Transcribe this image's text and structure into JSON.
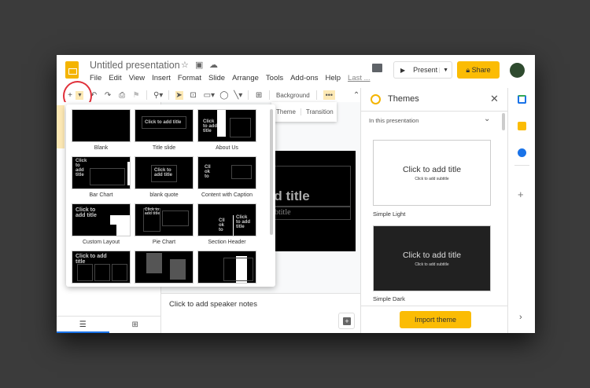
{
  "app": {
    "title": "Untitled presentation"
  },
  "menu": [
    "File",
    "Edit",
    "View",
    "Insert",
    "Format",
    "Slide",
    "Arrange",
    "Tools",
    "Add-ons",
    "Help"
  ],
  "last_edit": "Last ...",
  "header": {
    "present_label": "Present",
    "share_label": "Share"
  },
  "toolbar": {
    "background_label": "Background",
    "more_label": "•••"
  },
  "slide_bubble": {
    "theme_label": "Theme",
    "transition_label": "Transition"
  },
  "layouts": [
    {
      "label": "Blank"
    },
    {
      "label": "Title slide"
    },
    {
      "label": "About Us"
    },
    {
      "label": "Bar Chart"
    },
    {
      "label": "blank quote"
    },
    {
      "label": "Content with Caption"
    },
    {
      "label": "Custom Layout"
    },
    {
      "label": "Pie Chart"
    },
    {
      "label": "Section Header"
    },
    {
      "label": ""
    },
    {
      "label": ""
    },
    {
      "label": ""
    }
  ],
  "thumb_text": {
    "click_title": "Click to add title",
    "click_short": "Click to add title",
    "cll": "Cll ok to"
  },
  "slide": {
    "title": "dd title",
    "subtitle": "ubtitle"
  },
  "notes": {
    "placeholder": "Click to add speaker notes"
  },
  "themes": {
    "title": "Themes",
    "section": "In this presentation",
    "items": [
      {
        "name": "Simple Light",
        "title": "Click to add title",
        "subtitle": "Click to add subtitle"
      },
      {
        "name": "Simple Dark",
        "title": "Click to add title",
        "subtitle": "Click to add subtitle"
      }
    ],
    "import_label": "Import theme"
  },
  "colors": {
    "accent": "#fbbc04",
    "highlight": "#e0303a",
    "primary": "#1a73e8"
  }
}
